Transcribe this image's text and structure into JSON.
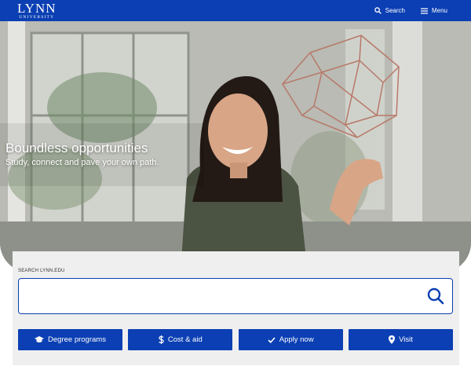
{
  "header": {
    "logo_main": "LYNN",
    "logo_sub": "UNIVERSITY",
    "search_label": "Search",
    "menu_label": "Menu"
  },
  "hero": {
    "title": "Boundless opportunities",
    "subtitle": "Study, connect and pave your own path."
  },
  "search": {
    "label": "SEARCH LYNN.EDU",
    "value": "",
    "placeholder": ""
  },
  "quick_links": [
    {
      "label": "Degree programs",
      "icon": "graduation-cap-icon"
    },
    {
      "label": "Cost & aid",
      "icon": "dollar-icon"
    },
    {
      "label": "Apply now",
      "icon": "checkmark-icon"
    },
    {
      "label": "Visit",
      "icon": "map-pin-icon"
    }
  ],
  "colors": {
    "brand_blue": "#0b3fb3",
    "panel_bg": "#efefef"
  }
}
